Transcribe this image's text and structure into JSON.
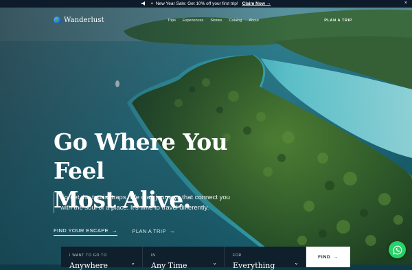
{
  "announcement": {
    "icon": "megaphone-icon",
    "accent_icon": "sparkle-icon",
    "text": "New Year Sale: Get 10% off your first trip!",
    "link": "Claim Now →",
    "close": "×"
  },
  "nav": {
    "brand": "Wanderlust",
    "links": [
      "Trips",
      "Experiences",
      "Stories",
      "Catalog",
      "About"
    ],
    "plan_label": "PLAN A TRIP"
  },
  "hero": {
    "title_line1": "Go Where You Feel",
    "title_line2": "Most Alive.",
    "subtitle": "Forget the tourist traps. We craft journeys that connect you with the soul of a place. It's time to travel differently.",
    "cta_primary": "FIND YOUR ESCAPE",
    "cta_secondary": "PLAN A TRIP",
    "arrow": "→"
  },
  "search": {
    "fields": [
      {
        "label": "I WANT TO GO TO",
        "value": "Anywhere"
      },
      {
        "label": "IN",
        "value": "Any Time"
      },
      {
        "label": "FOR",
        "value": "Everything"
      }
    ],
    "button": "FIND",
    "button_arrow": "→"
  },
  "chat": {
    "icon": "whatsapp-icon",
    "color": "#25d366"
  },
  "colors": {
    "bar": "#0d1b2a",
    "search_bg": "#0f1f2c",
    "sea": "#2fa3b4",
    "forest": "#2f5a2a"
  }
}
